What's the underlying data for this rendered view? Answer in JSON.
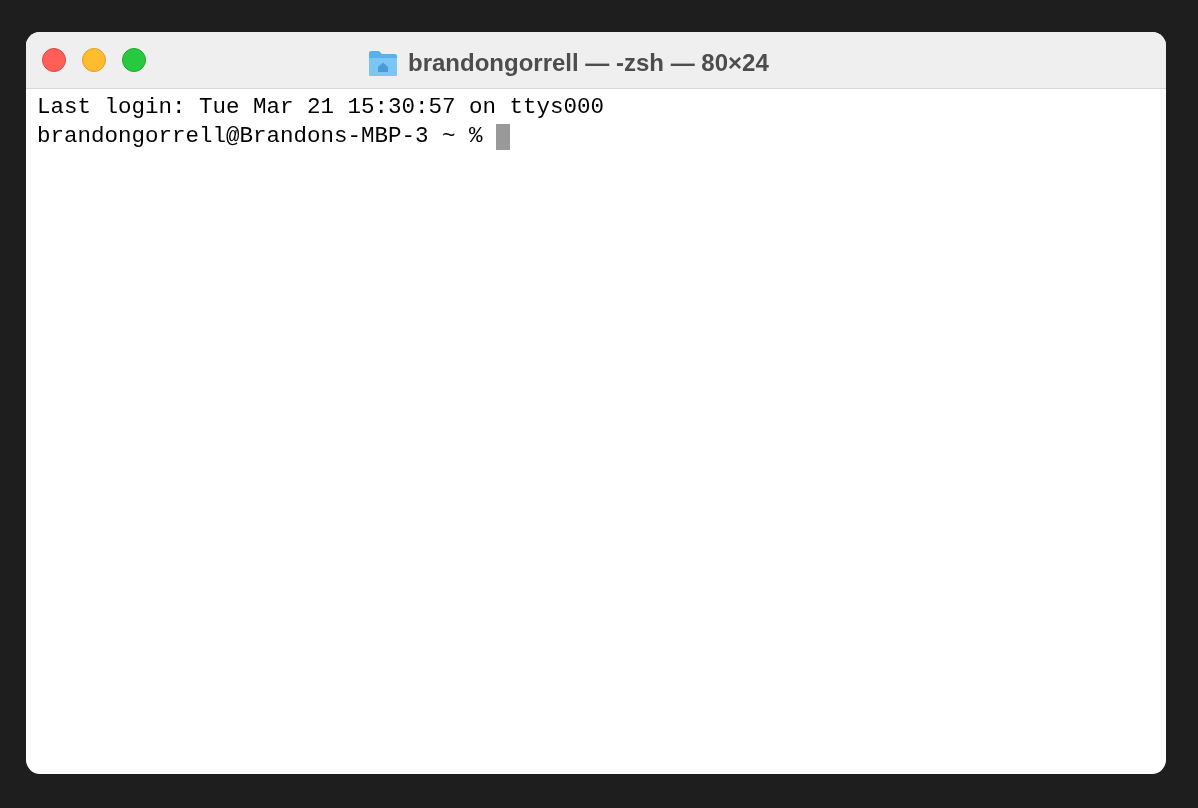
{
  "window": {
    "title": "brandongorrell — -zsh — 80×24"
  },
  "terminal": {
    "lines": [
      {
        "kind": "output",
        "text": "Last login: Tue Mar 21 15:30:57 on ttys000"
      },
      {
        "kind": "prompt",
        "text": "brandongorrell@Brandons-MBP-3 ~ %"
      }
    ]
  }
}
